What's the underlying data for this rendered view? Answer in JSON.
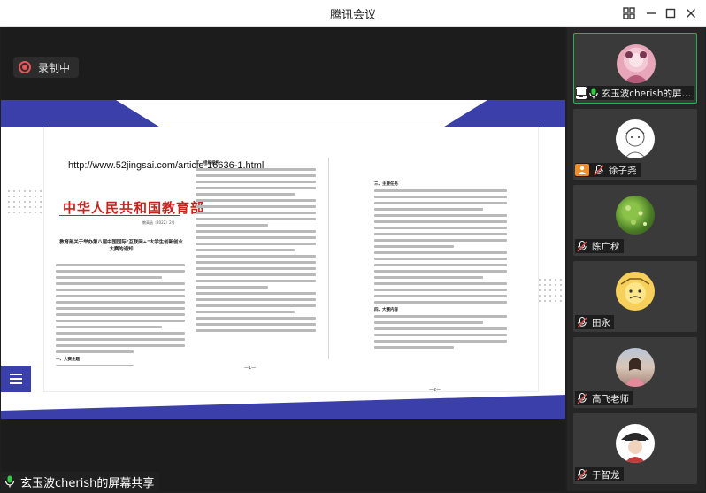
{
  "app": {
    "title": "腾讯会议",
    "window_buttons": [
      "grid-icon",
      "minimize-icon",
      "maximize-icon",
      "close-icon"
    ]
  },
  "recording": {
    "label": "录制中",
    "color": "#e35858"
  },
  "shared_content": {
    "url": "http://www.52jingsai.com/article-16636-1.html",
    "letterhead": "中华人民共和国教育部",
    "doc_number": "教高函〔2022〕2号",
    "notice_title": "教育部关于举办第八届中国国际\"互联网+\"大学生创新创业大赛的通知",
    "section_1": "一、大赛主题",
    "section_2": "二、组织机构",
    "section_3": "三、主要任务",
    "section_4": "四、大赛内容",
    "page_left": "—1—",
    "page_right": "—2—",
    "accent": "#3b3fa9"
  },
  "bottom_label": {
    "text": "玄玉波cherish的屏幕共享",
    "icon": "mic-on-icon",
    "mic_color": "#2ecc40"
  },
  "participants": [
    {
      "name": "玄玉波cherish的屏…",
      "badge": "screen-share-icon",
      "mic": "mic-on",
      "active": true,
      "avatar": "avatar-pink"
    },
    {
      "name": "徐子尧",
      "badge": "warning-user-icon",
      "mic": "mic-muted",
      "active": false,
      "avatar": "avatar-sketch"
    },
    {
      "name": "陈广秋",
      "badge": "",
      "mic": "mic-muted",
      "active": false,
      "avatar": "avatar-green"
    },
    {
      "name": "田永",
      "badge": "",
      "mic": "mic-muted",
      "active": false,
      "avatar": "avatar-yellow"
    },
    {
      "name": "高飞老师",
      "badge": "",
      "mic": "mic-muted",
      "active": false,
      "avatar": "avatar-photo"
    },
    {
      "name": "于智龙",
      "badge": "",
      "mic": "mic-muted",
      "active": false,
      "avatar": "avatar-hat"
    }
  ]
}
